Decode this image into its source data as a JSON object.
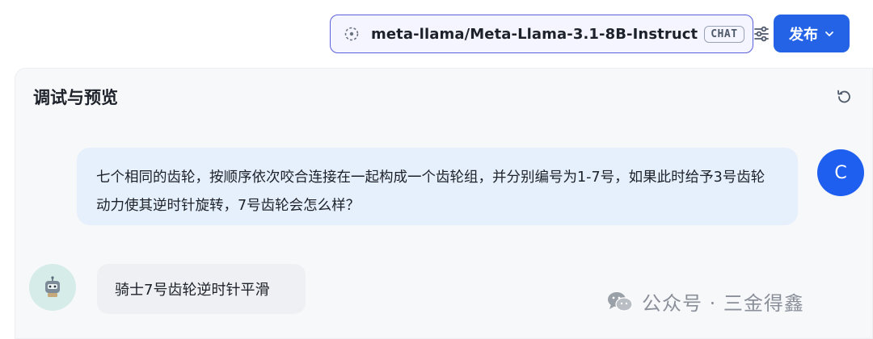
{
  "header": {
    "model_name": "meta-llama/Meta-Llama-3.1-8B-Instruct",
    "model_badge": "CHAT",
    "publish_label": "发布"
  },
  "panel": {
    "title": "调试与预览"
  },
  "conversation": {
    "user_message": "七个相同的齿轮，按顺序依次咬合连接在一起构成一个齿轮组，并分别编号为1-7号，如果此时给予3号齿轮动力使其逆时针旋转，7号齿轮会怎么样？",
    "user_avatar_letter": "C",
    "bot_reply": "骑士7号齿轮逆时针平滑"
  },
  "watermark": {
    "text": "公众号 · 三金得鑫"
  },
  "icons": {
    "model": "model-logo-icon",
    "settings": "sliders-icon",
    "publish_chevron": "chevron-down-icon",
    "reset": "refresh-icon",
    "bot": "robot-icon",
    "watermark": "wechat-icon"
  },
  "colors": {
    "accent": "#2563e6",
    "selector_border": "#5a5fdb",
    "user_bubble": "#e6f0fc",
    "user_avatar": "#1f5ff0",
    "bot_bubble": "#eef0f3",
    "bot_avatar": "#d6ece9"
  }
}
